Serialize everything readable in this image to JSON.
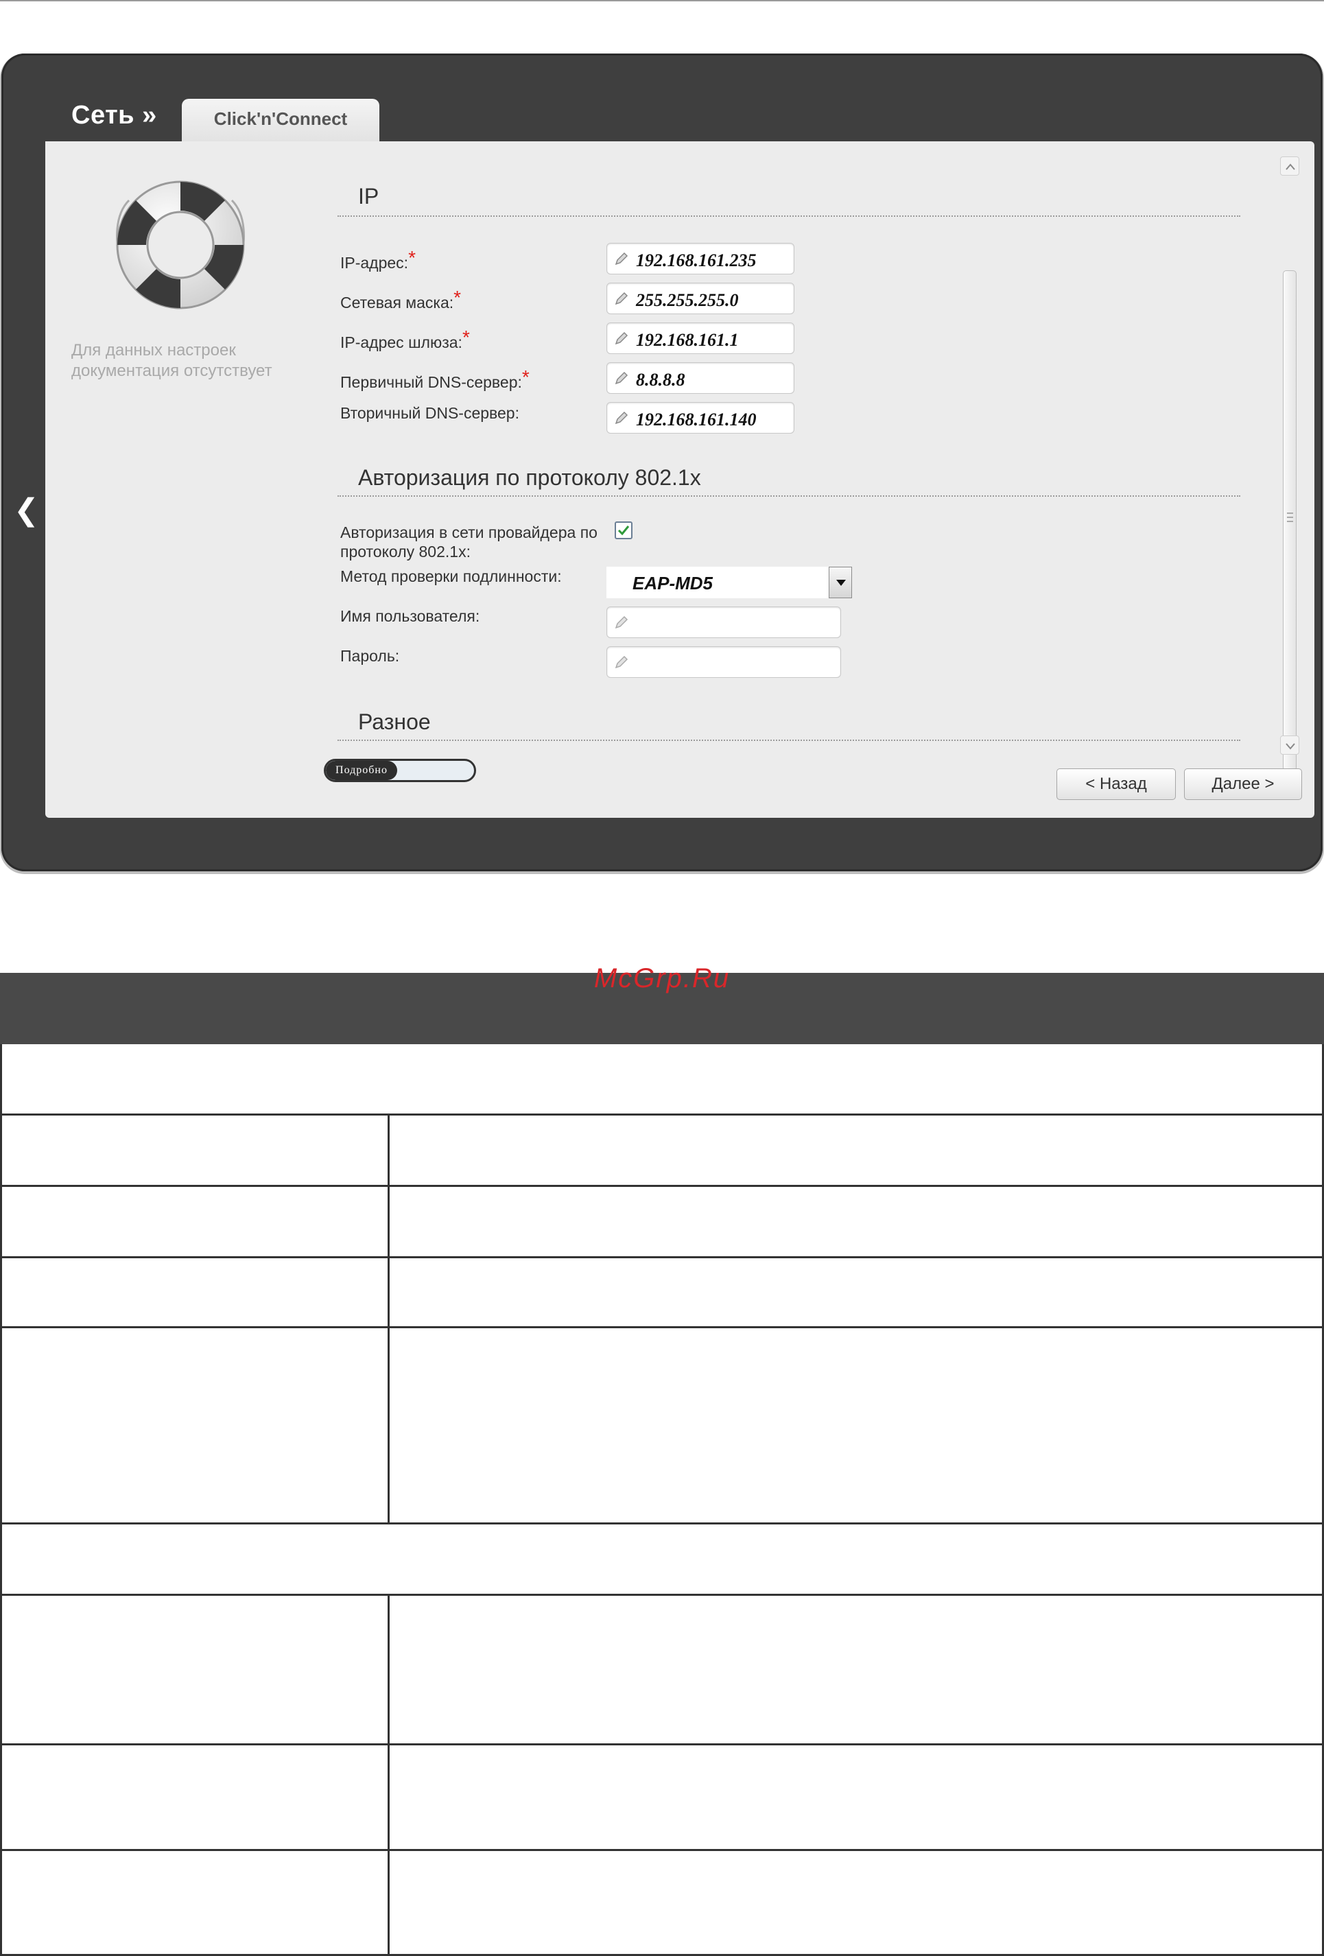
{
  "breadcrumb": "Сеть »",
  "tab_label": "Click'n'Connect",
  "side_note": "Для данных настроек документация отсутствует",
  "sections": {
    "ip": "IP",
    "auth": "Авторизация по протоколу 802.1x",
    "misc": "Разное"
  },
  "ip_fields": {
    "ip_address": {
      "label": "IP-адрес:",
      "value": "192.168.161.235"
    },
    "netmask": {
      "label": "Сетевая маска:",
      "value": "255.255.255.0"
    },
    "gateway": {
      "label": "IP-адрес шлюза:",
      "value": "192.168.161.1"
    },
    "dns_primary": {
      "label": "Первичный DNS-сервер:",
      "value": "8.8.8.8"
    },
    "dns_secondary": {
      "label": "Вторичный DNS-сервер:",
      "value": "192.168.161.140"
    }
  },
  "required_mark": "*",
  "auth_fields": {
    "enable_label_line1": "Авторизация в сети провайдера по",
    "enable_label_line2": "протоколу 802.1x:",
    "enable_checked": true,
    "method_label": "Метод проверки подлинности:",
    "method_value": "EAP-MD5",
    "username_label": "Имя пользователя:",
    "username_value": "",
    "password_label": "Пароль:",
    "password_value": ""
  },
  "details_toggle": "Подробно",
  "buttons": {
    "back": "< Назад",
    "next": "Далее >"
  },
  "watermark": "McGrp.Ru",
  "colors": {
    "frame": "#3f3f3f",
    "panel": "#ececec",
    "required": "#e0201a",
    "doc_header": "#494949"
  }
}
